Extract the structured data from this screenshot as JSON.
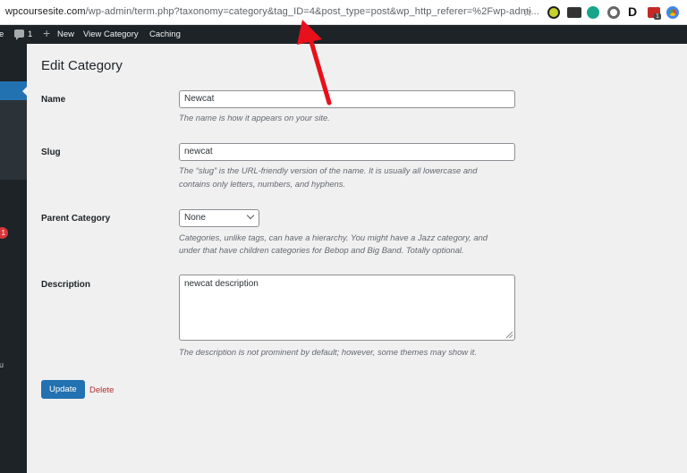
{
  "browser": {
    "url_domain": "wpcoursesite.com",
    "url_path": "/wp-admin/term.php?taxonomy=category&tag_ID=4&post_type=post&wp_http_referer=%2Fwp-admi...",
    "extension_badge": "1"
  },
  "adminbar": {
    "site_fragment": "e",
    "comment_count": "1",
    "new_label": "New",
    "view_label": "View Category",
    "caching_label": "Caching"
  },
  "sidebar": {
    "update_badge": "1",
    "partial_label": "u"
  },
  "page": {
    "title": "Edit Category"
  },
  "form": {
    "name": {
      "label": "Name",
      "value": "Newcat",
      "description": "The name is how it appears on your site."
    },
    "slug": {
      "label": "Slug",
      "value": "newcat",
      "description_line1": "The “slug” is the URL-friendly version of the name. It is usually all lowercase and",
      "description_line2": "contains only letters, numbers, and hyphens."
    },
    "parent": {
      "label": "Parent Category",
      "selected": "None",
      "description_line1": "Categories, unlike tags, can have a hierarchy. You might have a Jazz category, and",
      "description_line2": "under that have children categories for Bebop and Big Band. Totally optional."
    },
    "description": {
      "label": "Description",
      "value": "newcat description",
      "help": "The description is not prominent by default; however, some themes may show it."
    },
    "update_label": "Update",
    "delete_label": "Delete"
  },
  "colors": {
    "primary": "#2271b1",
    "admin_dark": "#1d2327",
    "delete": "#b32d2e",
    "annotation": "#e8101a"
  }
}
